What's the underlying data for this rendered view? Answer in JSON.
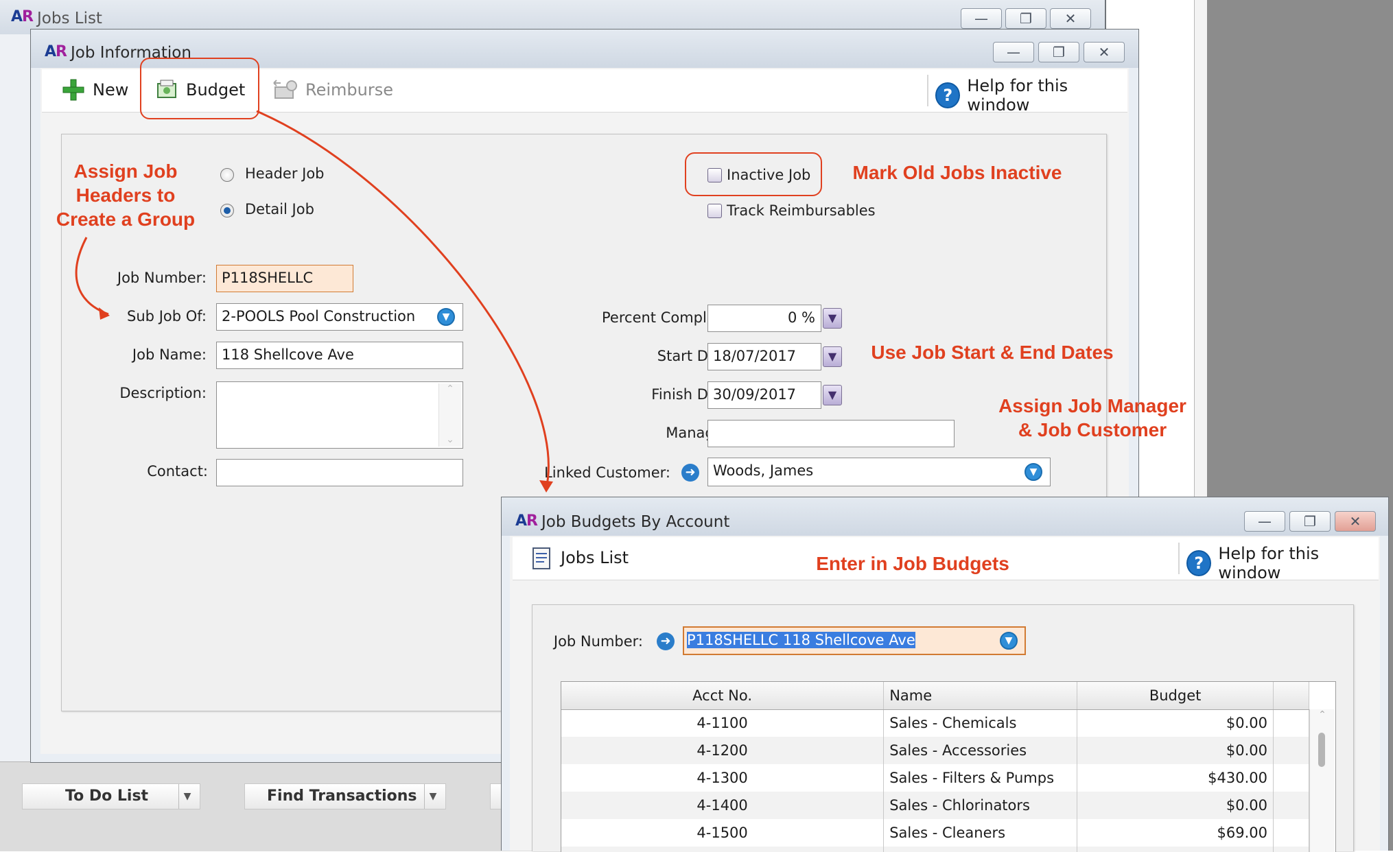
{
  "jobs_list_window": {
    "title": "Jobs List",
    "bottom_buttons": [
      {
        "label": "To Do List"
      },
      {
        "label": "Find Transactions"
      }
    ]
  },
  "job_info_window": {
    "title": "Job Information",
    "toolbar": {
      "new_label": "New",
      "budget_label": "Budget",
      "reimburse_label": "Reimburse",
      "help_label": "Help for this window"
    },
    "job_type": {
      "header_label": "Header Job",
      "detail_label": "Detail Job",
      "selected": "Detail Job"
    },
    "inactive_label": "Inactive Job",
    "track_label": "Track Reimbursables",
    "fields": {
      "job_number_label": "Job Number:",
      "job_number": "P118SHELLC",
      "sub_job_label": "Sub Job Of:",
      "sub_job": "2-POOLS Pool Construction",
      "job_name_label": "Job Name:",
      "job_name": "118 Shellcove Ave",
      "description_label": "Description:",
      "description": "",
      "contact_label": "Contact:",
      "contact": "",
      "percent_label": "Percent Complete:",
      "percent": "0 %",
      "start_label": "Start Date:",
      "start": "18/07/2017",
      "finish_label": "Finish Date:",
      "finish": "30/09/2017",
      "manager_label": "Manager:",
      "manager": "",
      "linked_label": "Linked Customer:",
      "linked": "Woods, James"
    }
  },
  "budget_window": {
    "title": "Job Budgets By Account",
    "jobs_list_label": "Jobs List",
    "help_label": "Help for this window",
    "job_number_label": "Job Number:",
    "job_number": "P118SHELLC 118 Shellcove Ave",
    "columns": [
      "Acct No.",
      "Name",
      "Budget"
    ],
    "rows": [
      {
        "acct": "4-1100",
        "name": "Sales - Chemicals",
        "budget": "$0.00"
      },
      {
        "acct": "4-1200",
        "name": "Sales - Accessories",
        "budget": "$0.00"
      },
      {
        "acct": "4-1300",
        "name": "Sales - Filters & Pumps",
        "budget": "$430.00"
      },
      {
        "acct": "4-1400",
        "name": "Sales - Chlorinators",
        "budget": "$0.00"
      },
      {
        "acct": "4-1500",
        "name": "Sales - Cleaners",
        "budget": "$69.00"
      }
    ]
  },
  "annotations": {
    "assign_headers_1": "Assign Job",
    "assign_headers_2": "Headers to",
    "assign_headers_3": "Create a Group",
    "mark_inactive": "Mark Old Jobs Inactive",
    "use_dates": "Use Job Start & End Dates",
    "assign_manager_1": "Assign Job Manager",
    "assign_manager_2": "& Job Customer",
    "enter_budgets": "Enter in Job Budgets"
  },
  "colors": {
    "annotation_red": "#e0401f",
    "highlight_field": "#fde8d6",
    "accent_blue": "#1f74c6"
  }
}
